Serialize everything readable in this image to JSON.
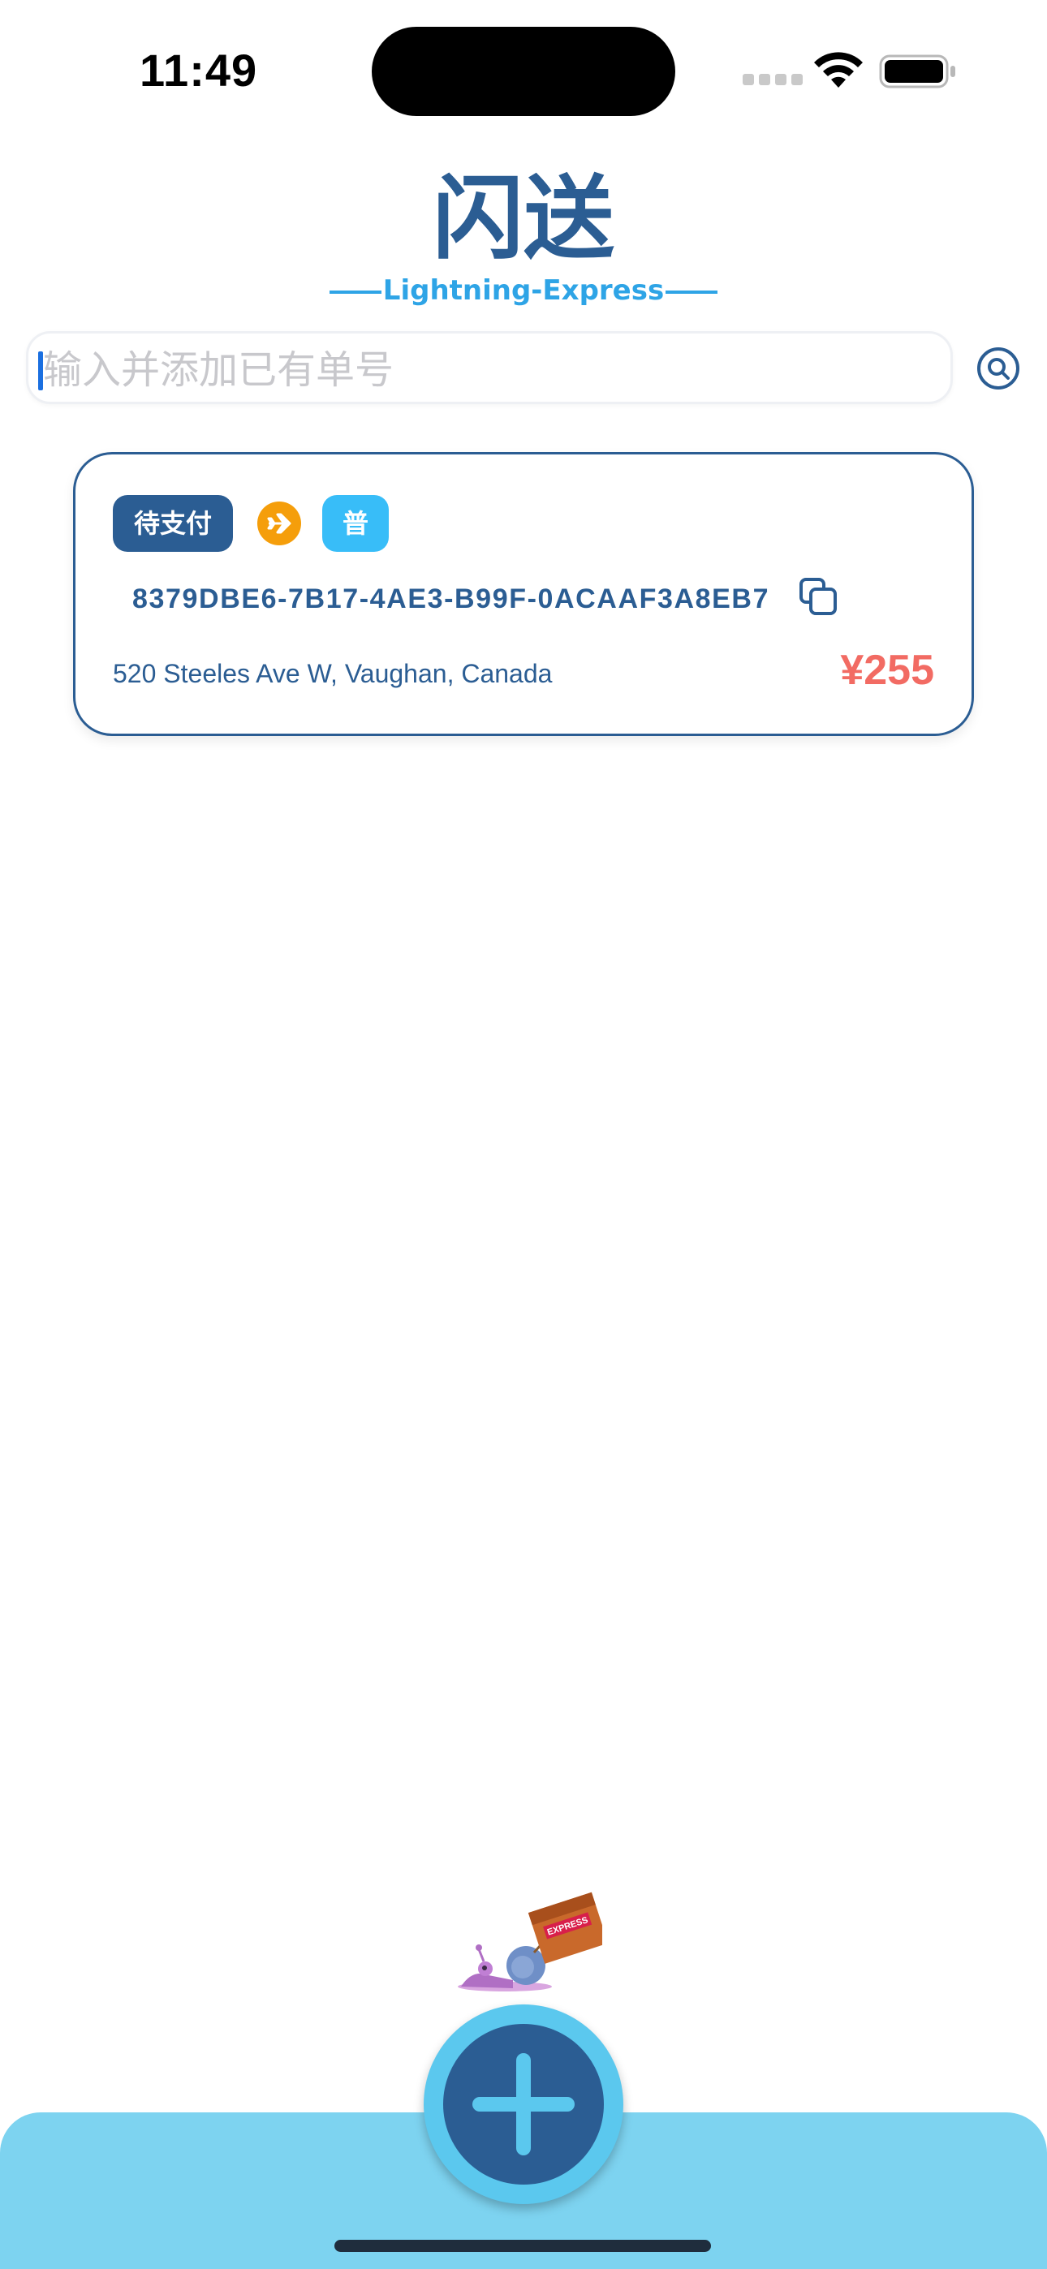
{
  "status_bar": {
    "time": "11:49"
  },
  "header": {
    "title": "闪送",
    "subtitle": "Lightning-Express"
  },
  "search": {
    "placeholder": "输入并添加已有单号",
    "icon": "search-icon"
  },
  "orders": [
    {
      "status": "待支付",
      "shipping_icon": "airplane-icon",
      "type": "普",
      "order_number": "8379DBE6-7B17-4AE3-B99F-0ACAAF3A8EB7",
      "address": "520 Steeles Ave W, Vaughan, Canada",
      "price": "¥255"
    }
  ],
  "mascot": {
    "label": "EXPRESS"
  },
  "colors": {
    "primary": "#2b5d93",
    "accent": "#2ea4e6",
    "price": "#f26b63",
    "tab_bar": "#7dd3f0",
    "plane_badge": "#f59e0b",
    "type_badge": "#38bdf8"
  }
}
